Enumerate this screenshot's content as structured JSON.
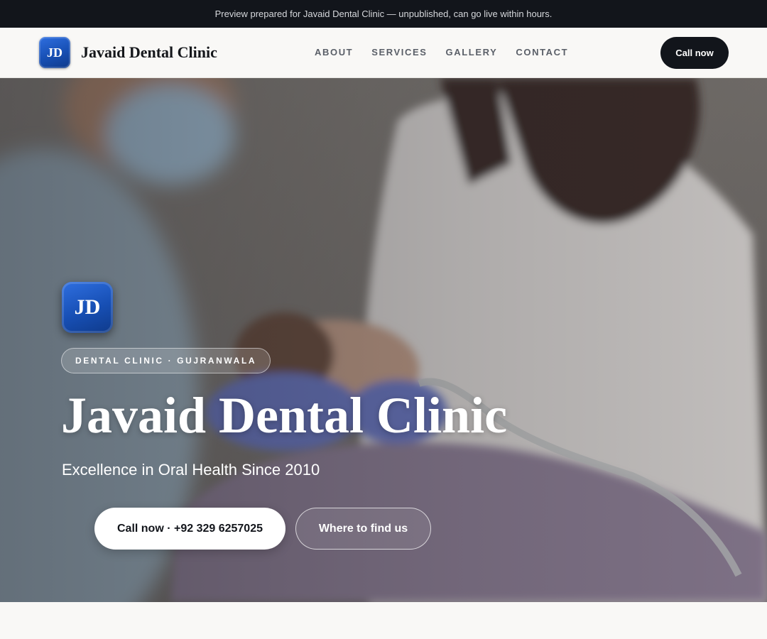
{
  "banner": {
    "text": "Preview prepared for Javaid Dental Clinic — unpublished, can go live within hours."
  },
  "header": {
    "logo_initials": "JD",
    "brand_name": "Javaid Dental Clinic",
    "nav": [
      "ABOUT",
      "SERVICES",
      "GALLERY",
      "CONTACT"
    ],
    "cta_label": "Call now"
  },
  "hero": {
    "badge_initials": "JD",
    "eyebrow": "DENTAL CLINIC · GUJRANWALA",
    "title": "Javaid Dental Clinic",
    "subtitle": "Excellence in Oral Health Since 2010",
    "primary_button": "Call now · +92 329 6257025",
    "secondary_button": "Where to find us"
  },
  "colors": {
    "banner_bg": "#12151b",
    "page_bg": "#f9f8f6",
    "brand_blue": "#174fb4",
    "dark_button": "#12151b"
  }
}
